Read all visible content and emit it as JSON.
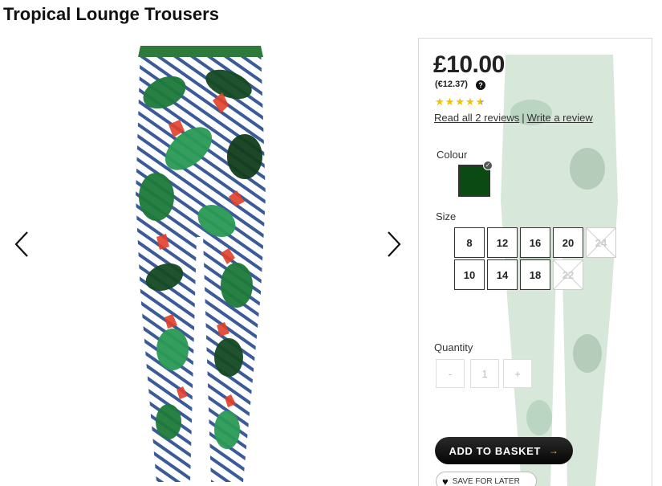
{
  "product": {
    "title": "Tropical Lounge Trousers"
  },
  "gallery": {
    "prev_icon": "chevron-left-icon",
    "next_icon": "chevron-right-icon"
  },
  "pricing": {
    "price": "£10.00",
    "alt_price": "(€12.37)",
    "help_icon": "?"
  },
  "rating": {
    "value": 4.5,
    "max": 5,
    "star_glyph": "★"
  },
  "reviews": {
    "read_label": "Read all 2 reviews",
    "separator": "|",
    "write_label": "Write a review"
  },
  "colour": {
    "label": "Colour",
    "selected": "dark green",
    "swatch_hex": "#0b4a12",
    "check_icon": "✓"
  },
  "size": {
    "label": "Size",
    "options": [
      {
        "label": "8",
        "available": true
      },
      {
        "label": "12",
        "available": true
      },
      {
        "label": "16",
        "available": true
      },
      {
        "label": "20",
        "available": true
      },
      {
        "label": "24",
        "available": false
      },
      {
        "label": "10",
        "available": true
      },
      {
        "label": "14",
        "available": true
      },
      {
        "label": "18",
        "available": true
      },
      {
        "label": "22",
        "available": false
      }
    ]
  },
  "quantity": {
    "label": "Quantity",
    "minus": "-",
    "value": "1",
    "plus": "+"
  },
  "actions": {
    "add_to_basket": "ADD TO BASKET",
    "add_arrow": "→",
    "save_for_later": "SAVE FOR LATER",
    "heart_icon": "♥"
  },
  "colors": {
    "accent": "#f2c200",
    "text": "#222222",
    "border": "#d8d8d8"
  }
}
